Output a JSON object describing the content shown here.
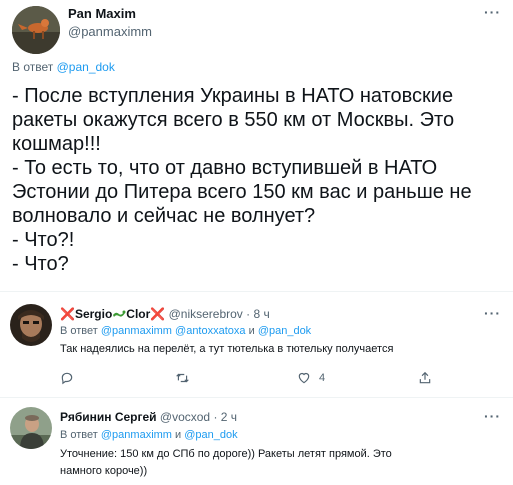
{
  "main_tweet": {
    "author_name": "Pan Maxim",
    "author_handle": "@panmaximm",
    "reply_prefix": "В ответ",
    "reply_to": "@pan_dok",
    "more_label": "···",
    "lines": [
      "- После вступления Украины в НАТО натовские",
      "ракеты окажутся всего в 550 км от Москвы. Это",
      "кошмар!!!",
      "- То есть то, что от давно  вступившей  в НАТО",
      "Эстонии до Питера всего 150 км вас и раньше не",
      "волновало и сейчас не волнует?",
      "- Что?!",
      "- Что?"
    ]
  },
  "reply1": {
    "name_part1": "Sergio",
    "name_part2": "Clor",
    "handle": "@nikserebrov",
    "separator": "·",
    "time": "8 ч",
    "more_label": "···",
    "reply_prefix": "В ответ",
    "reply_to_1": "@panmaximm",
    "reply_to_2": "@antoxxatoxa",
    "conj": "и",
    "reply_to_3": "@pan_dok",
    "text": "Так надеялись на перелёт, а тут тютелька в тютельку получается",
    "likes": "4",
    "icons": [
      "reply-icon",
      "retweet-icon",
      "like-icon",
      "share-icon"
    ],
    "colors": {
      "x": "#e0245e",
      "lizard": "#3d9b35"
    }
  },
  "reply2": {
    "name": "Рябинин Сергей",
    "handle": "@vocxod",
    "separator": "·",
    "time": "2 ч",
    "more_label": "···",
    "reply_prefix": "В ответ",
    "reply_to_1": "@panmaximm",
    "conj": "и",
    "reply_to_2": "@pan_dok",
    "text_lines": [
      "Уточнение: 150 км до СПб по дороге)) Ракеты летят прямой. Это",
      "намного короче))"
    ]
  },
  "colors": {
    "link": "#1d9bf0",
    "secondary_text": "#536471",
    "text": "#0f1419",
    "divider": "#eff3f4"
  }
}
